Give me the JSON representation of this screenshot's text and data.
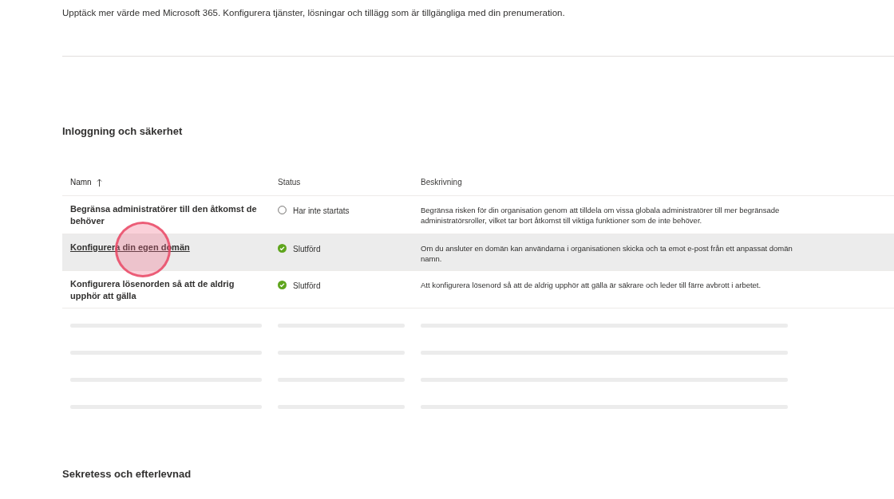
{
  "intro": "Upptäck mer värde med Microsoft 365. Konfigurera tjänster, lösningar och tillägg som är tillgängliga med din prenumeration.",
  "sections": [
    {
      "title": "Inloggning och säkerhet",
      "table": {
        "columns": [
          {
            "label": "Namn",
            "sorted": true
          },
          {
            "label": "Status",
            "sorted": false
          },
          {
            "label": "Beskrivning",
            "sorted": false
          }
        ],
        "rows": [
          {
            "name": "Begränsa administratörer till den åtkomst de behöver",
            "status": "Har inte startats",
            "kind": "not_started",
            "hovered": false,
            "description": "Begränsa risken för din organisation genom att tilldela om vissa globala administratörer till mer begränsade administratörsroller, vilket tar bort åtkomst till viktiga funktioner som de inte behöver."
          },
          {
            "name": "Konfigurera din egen domän ",
            "status": "Slutförd",
            "kind": "completed",
            "hovered": true,
            "description": "Om du ansluter en domän kan användarna i organisationen skicka och ta emot e-post från ett anpassat domän namn."
          },
          {
            "name": "Konfigurera lösenorden så att de aldrig upphör att gälla",
            "status": "Slutförd",
            "kind": "completed",
            "hovered": false,
            "description": "Att konfigurera lösenord så att de aldrig upphör att gälla är säkrare och leder till färre avbrott i arbetet."
          }
        ],
        "loading_rows": [
          {
            "kind": "skeleton"
          },
          {
            "kind": "skeleton"
          },
          {
            "kind": "skeleton"
          },
          {
            "kind": "skeleton"
          }
        ]
      }
    },
    {
      "title": "Sekretess och efterlevnad"
    }
  ],
  "click_marker": {
    "on": true
  }
}
